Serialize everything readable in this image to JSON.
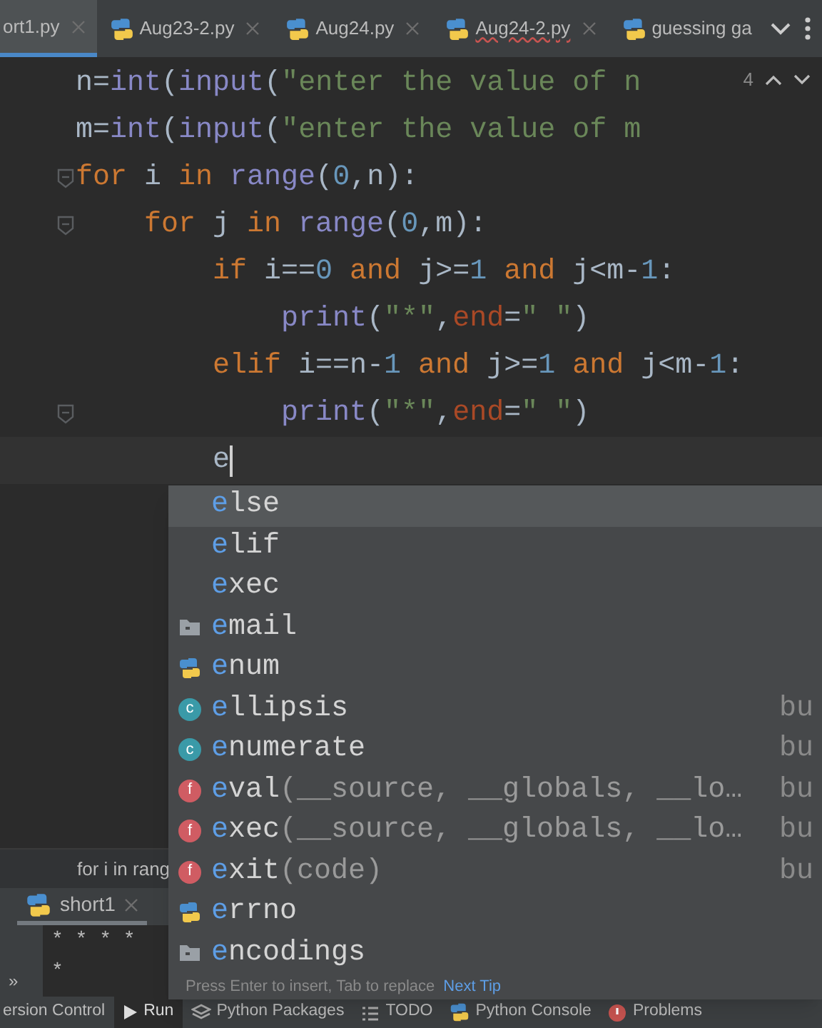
{
  "tabs": [
    {
      "label": "ort1.py",
      "kind": "clipped",
      "selected": true,
      "error": false
    },
    {
      "label": "Aug23-2.py",
      "kind": "file",
      "selected": false,
      "error": false
    },
    {
      "label": "Aug24.py",
      "kind": "file",
      "selected": false,
      "error": false
    },
    {
      "label": "Aug24-2.py",
      "kind": "file",
      "selected": false,
      "error": true
    },
    {
      "label": "guessing ga",
      "kind": "file",
      "selected": false,
      "error": false
    }
  ],
  "inspections": {
    "count": "4"
  },
  "code": [
    {
      "tokens": [
        {
          "text": "n=",
          "kind": "plain"
        },
        {
          "text": "int",
          "kind": "builtin"
        },
        {
          "text": "(",
          "kind": "plain"
        },
        {
          "text": "input",
          "kind": "builtin"
        },
        {
          "text": "(",
          "kind": "plain"
        },
        {
          "text": "\"enter the value of n",
          "kind": "str"
        }
      ]
    },
    {
      "tokens": [
        {
          "text": "m=",
          "kind": "plain"
        },
        {
          "text": "int",
          "kind": "builtin"
        },
        {
          "text": "(",
          "kind": "plain"
        },
        {
          "text": "input",
          "kind": "builtin"
        },
        {
          "text": "(",
          "kind": "plain"
        },
        {
          "text": "\"enter the value of m",
          "kind": "str"
        }
      ]
    },
    {
      "fold": true,
      "tokens": [
        {
          "text": "for",
          "kind": "kw"
        },
        {
          "text": " i ",
          "kind": "plain"
        },
        {
          "text": "in ",
          "kind": "kw"
        },
        {
          "text": "range",
          "kind": "builtin"
        },
        {
          "text": "(",
          "kind": "plain"
        },
        {
          "text": "0",
          "kind": "num"
        },
        {
          "text": ",n):",
          "kind": "plain"
        }
      ],
      "children": [
        {
          "fold": true,
          "tokens": [
            {
              "text": "for",
              "kind": "kw"
            },
            {
              "text": " j ",
              "kind": "plain"
            },
            {
              "text": "in ",
              "kind": "kw"
            },
            {
              "text": "range",
              "kind": "builtin"
            },
            {
              "text": "(",
              "kind": "plain"
            },
            {
              "text": "0",
              "kind": "num"
            },
            {
              "text": ",m):",
              "kind": "plain"
            }
          ],
          "children": [
            {
              "tokens": [
                {
                  "text": "if",
                  "kind": "kw"
                },
                {
                  "text": " i==",
                  "kind": "plain"
                },
                {
                  "text": "0",
                  "kind": "num"
                },
                {
                  "text": " and",
                  "kind": "kw"
                },
                {
                  "text": " j>=",
                  "kind": "plain"
                },
                {
                  "text": "1",
                  "kind": "num"
                },
                {
                  "text": " and",
                  "kind": "kw"
                },
                {
                  "text": " j<m-",
                  "kind": "plain"
                },
                {
                  "text": "1",
                  "kind": "num"
                },
                {
                  "text": ":",
                  "kind": "plain"
                }
              ],
              "children": [
                {
                  "tokens": [
                    {
                      "text": "print",
                      "kind": "builtin"
                    },
                    {
                      "text": "(",
                      "kind": "plain"
                    },
                    {
                      "text": "\"*\"",
                      "kind": "str"
                    },
                    {
                      "text": ",",
                      "kind": "plain"
                    },
                    {
                      "text": "end",
                      "kind": "param"
                    },
                    {
                      "text": "=",
                      "kind": "plain"
                    },
                    {
                      "text": "\" \"",
                      "kind": "str"
                    },
                    {
                      "text": ")",
                      "kind": "plain"
                    }
                  ]
                }
              ]
            },
            {
              "tokens": [
                {
                  "text": "elif",
                  "kind": "kw"
                },
                {
                  "text": " i==n-",
                  "kind": "plain"
                },
                {
                  "text": "1",
                  "kind": "num"
                },
                {
                  "text": " and",
                  "kind": "kw"
                },
                {
                  "text": " j>=",
                  "kind": "plain"
                },
                {
                  "text": "1",
                  "kind": "num"
                },
                {
                  "text": " and",
                  "kind": "kw"
                },
                {
                  "text": " j<m-",
                  "kind": "plain"
                },
                {
                  "text": "1",
                  "kind": "num"
                },
                {
                  "text": ":",
                  "kind": "plain"
                }
              ],
              "children": [
                {
                  "fold": true,
                  "tokens": [
                    {
                      "text": "print",
                      "kind": "builtin"
                    },
                    {
                      "text": "(",
                      "kind": "plain"
                    },
                    {
                      "text": "\"*\"",
                      "kind": "str"
                    },
                    {
                      "text": ",",
                      "kind": "plain"
                    },
                    {
                      "text": "end",
                      "kind": "param"
                    },
                    {
                      "text": "=",
                      "kind": "plain"
                    },
                    {
                      "text": "\" \"",
                      "kind": "str"
                    },
                    {
                      "text": ")",
                      "kind": "plain"
                    }
                  ]
                }
              ]
            },
            {
              "current": true,
              "tokens": [
                {
                  "text": "e",
                  "kind": "plain"
                }
              ]
            }
          ]
        }
      ]
    }
  ],
  "breadcrumb": "for i in rang",
  "run_panel": {
    "tab": "short1",
    "output": [
      "* * * *",
      "*"
    ],
    "more": "»"
  },
  "completion": {
    "items": [
      {
        "kind": "keyword",
        "match": "e",
        "rest": "lse",
        "selected": true
      },
      {
        "kind": "keyword",
        "match": "e",
        "rest": "lif",
        "selected": false
      },
      {
        "kind": "keyword",
        "match": "e",
        "rest": "xec",
        "selected": false
      },
      {
        "kind": "package",
        "match": "e",
        "rest": "mail",
        "selected": false
      },
      {
        "kind": "module",
        "match": "e",
        "rest": "num",
        "selected": false
      },
      {
        "kind": "class",
        "badge": "c",
        "match": "e",
        "rest": "llipsis",
        "type": "bu",
        "selected": false
      },
      {
        "kind": "class",
        "badge": "c",
        "match": "e",
        "rest": "numerate",
        "type": "bu",
        "selected": false
      },
      {
        "kind": "function",
        "badge": "f",
        "match": "e",
        "rest": "val",
        "params": "(__source, __globals, __lo…",
        "type": "bu",
        "selected": false
      },
      {
        "kind": "function",
        "badge": "f",
        "match": "e",
        "rest": "xec",
        "params": "(__source, __globals, __lo…",
        "type": "bu",
        "selected": false
      },
      {
        "kind": "function",
        "badge": "f",
        "match": "e",
        "rest": "xit",
        "params": "(code)",
        "type": "bu",
        "selected": false
      },
      {
        "kind": "module",
        "match": "e",
        "rest": "rrno",
        "selected": false
      },
      {
        "kind": "package",
        "match": "e",
        "rest": "ncodings",
        "selected": false
      }
    ],
    "hint": "Press Enter to insert, Tab to replace",
    "tip_link": "Next Tip"
  },
  "bottom_bar": [
    {
      "label": "ersion Control",
      "kind": "plain",
      "selected": false
    },
    {
      "label": "Run",
      "kind": "run",
      "selected": true
    },
    {
      "label": "Python Packages",
      "kind": "packages",
      "selected": false
    },
    {
      "label": "TODO",
      "kind": "todo",
      "selected": false
    },
    {
      "label": "Python Console",
      "kind": "console",
      "selected": false
    },
    {
      "label": "Problems",
      "kind": "problems",
      "selected": false
    }
  ]
}
